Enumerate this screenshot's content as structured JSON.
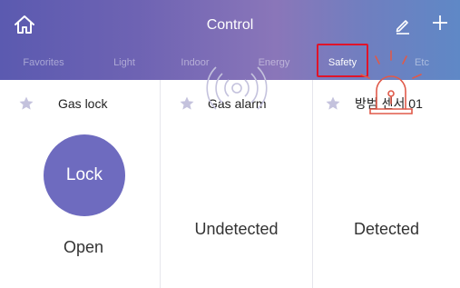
{
  "header": {
    "title": "Control",
    "icons": {
      "home": "home-icon",
      "edit": "pencil-icon",
      "add": "plus-icon"
    },
    "tabs": [
      {
        "label": "Favorites",
        "active": false
      },
      {
        "label": "Light",
        "active": false
      },
      {
        "label": "Indoor",
        "active": false
      },
      {
        "label": "Energy",
        "active": false
      },
      {
        "label": "Safety",
        "active": true
      },
      {
        "label": "Etc",
        "active": false
      }
    ],
    "highlight_color": "#e0142a"
  },
  "cards": [
    {
      "title": "Gas lock",
      "button_label": "Lock",
      "status": "Open",
      "icon": "star-icon"
    },
    {
      "title": "Gas alarm",
      "status": "Undetected",
      "icon": "star-icon",
      "device_icon": "signal-waves-icon"
    },
    {
      "title": "방범 센서 01",
      "status": "Detected",
      "icon": "star-icon",
      "device_icon": "siren-icon"
    }
  ],
  "colors": {
    "accent": "#6e6bbf",
    "alert": "#e05a4a",
    "muted_icon": "#c4c2dd"
  }
}
